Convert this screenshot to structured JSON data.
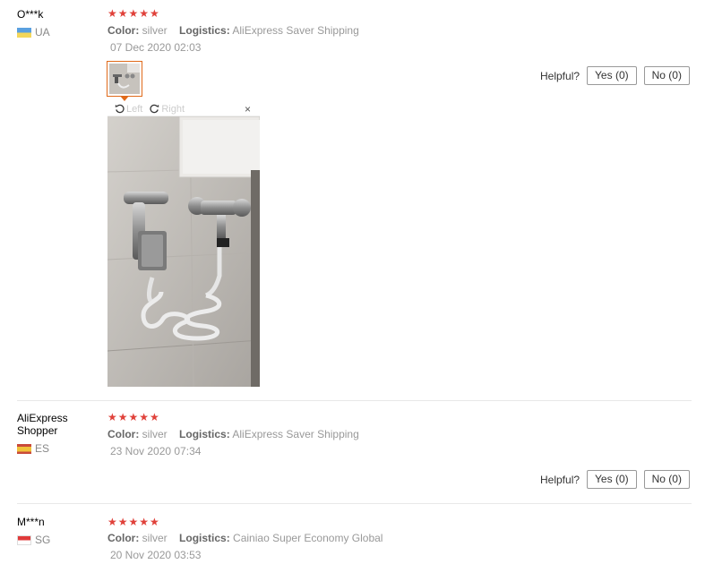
{
  "reviews": [
    {
      "user": "O***k",
      "country": "UA",
      "stars": "★★★★★",
      "color_label": "Color:",
      "color_value": "silver",
      "logistics_label": "Logistics:",
      "logistics_value": "AliExpress Saver Shipping",
      "date": "07 Dec 2020 02:03"
    },
    {
      "user": "AliExpress Shopper",
      "country": "ES",
      "stars": "★★★★★",
      "color_label": "Color:",
      "color_value": "silver",
      "logistics_label": "Logistics:",
      "logistics_value": "AliExpress Saver Shipping",
      "date": "23 Nov 2020 07:34"
    },
    {
      "user": "M***n",
      "country": "SG",
      "stars": "★★★★★",
      "color_label": "Color:",
      "color_value": "silver",
      "logistics_label": "Logistics:",
      "logistics_value": "Cainiao Super Economy Global",
      "date": "20 Nov 2020 03:53"
    }
  ],
  "helpful": {
    "label": "Helpful?",
    "yes": "Yes (0)",
    "no": "No (0)"
  },
  "viewer": {
    "rotate_left": "Left",
    "rotate_right": "Right",
    "close": "×"
  },
  "colors": {
    "star": "#e0413a",
    "thumb_border": "#e06a1a"
  }
}
